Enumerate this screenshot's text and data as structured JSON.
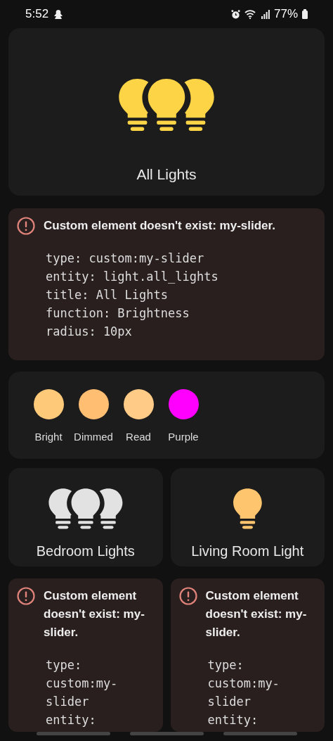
{
  "status_bar": {
    "time": "5:52",
    "battery": "77%"
  },
  "hero": {
    "title": "All Lights",
    "kind": "group",
    "color": "#fdd446"
  },
  "error_wide": {
    "message": "Custom element doesn't exist: my-slider.",
    "lines": [
      "type: custom:my-slider",
      "entity: light.all_lights",
      "title: All Lights",
      "function: Brightness",
      "radius: 10px"
    ]
  },
  "scenes": [
    {
      "label": "Bright",
      "color": "#ffc97a"
    },
    {
      "label": "Dimmed",
      "color": "#ffbe72"
    },
    {
      "label": "Read",
      "color": "#ffcb87"
    },
    {
      "label": "Purple",
      "color": "#ff00ff"
    }
  ],
  "tiles": [
    {
      "title": "Bedroom Lights",
      "kind": "group",
      "color": "#e2e2e2"
    },
    {
      "title": "Living Room Light",
      "kind": "single",
      "color": "#ffc56e"
    }
  ],
  "errors": [
    {
      "message": "Custom element doesn't exist: my-slider.",
      "lines": [
        "type:",
        "custom:my-",
        "slider",
        "entity:"
      ]
    },
    {
      "message": "Custom element doesn't exist: my-slider.",
      "lines": [
        "type:",
        "custom:my-",
        "slider",
        "entity:"
      ]
    }
  ]
}
